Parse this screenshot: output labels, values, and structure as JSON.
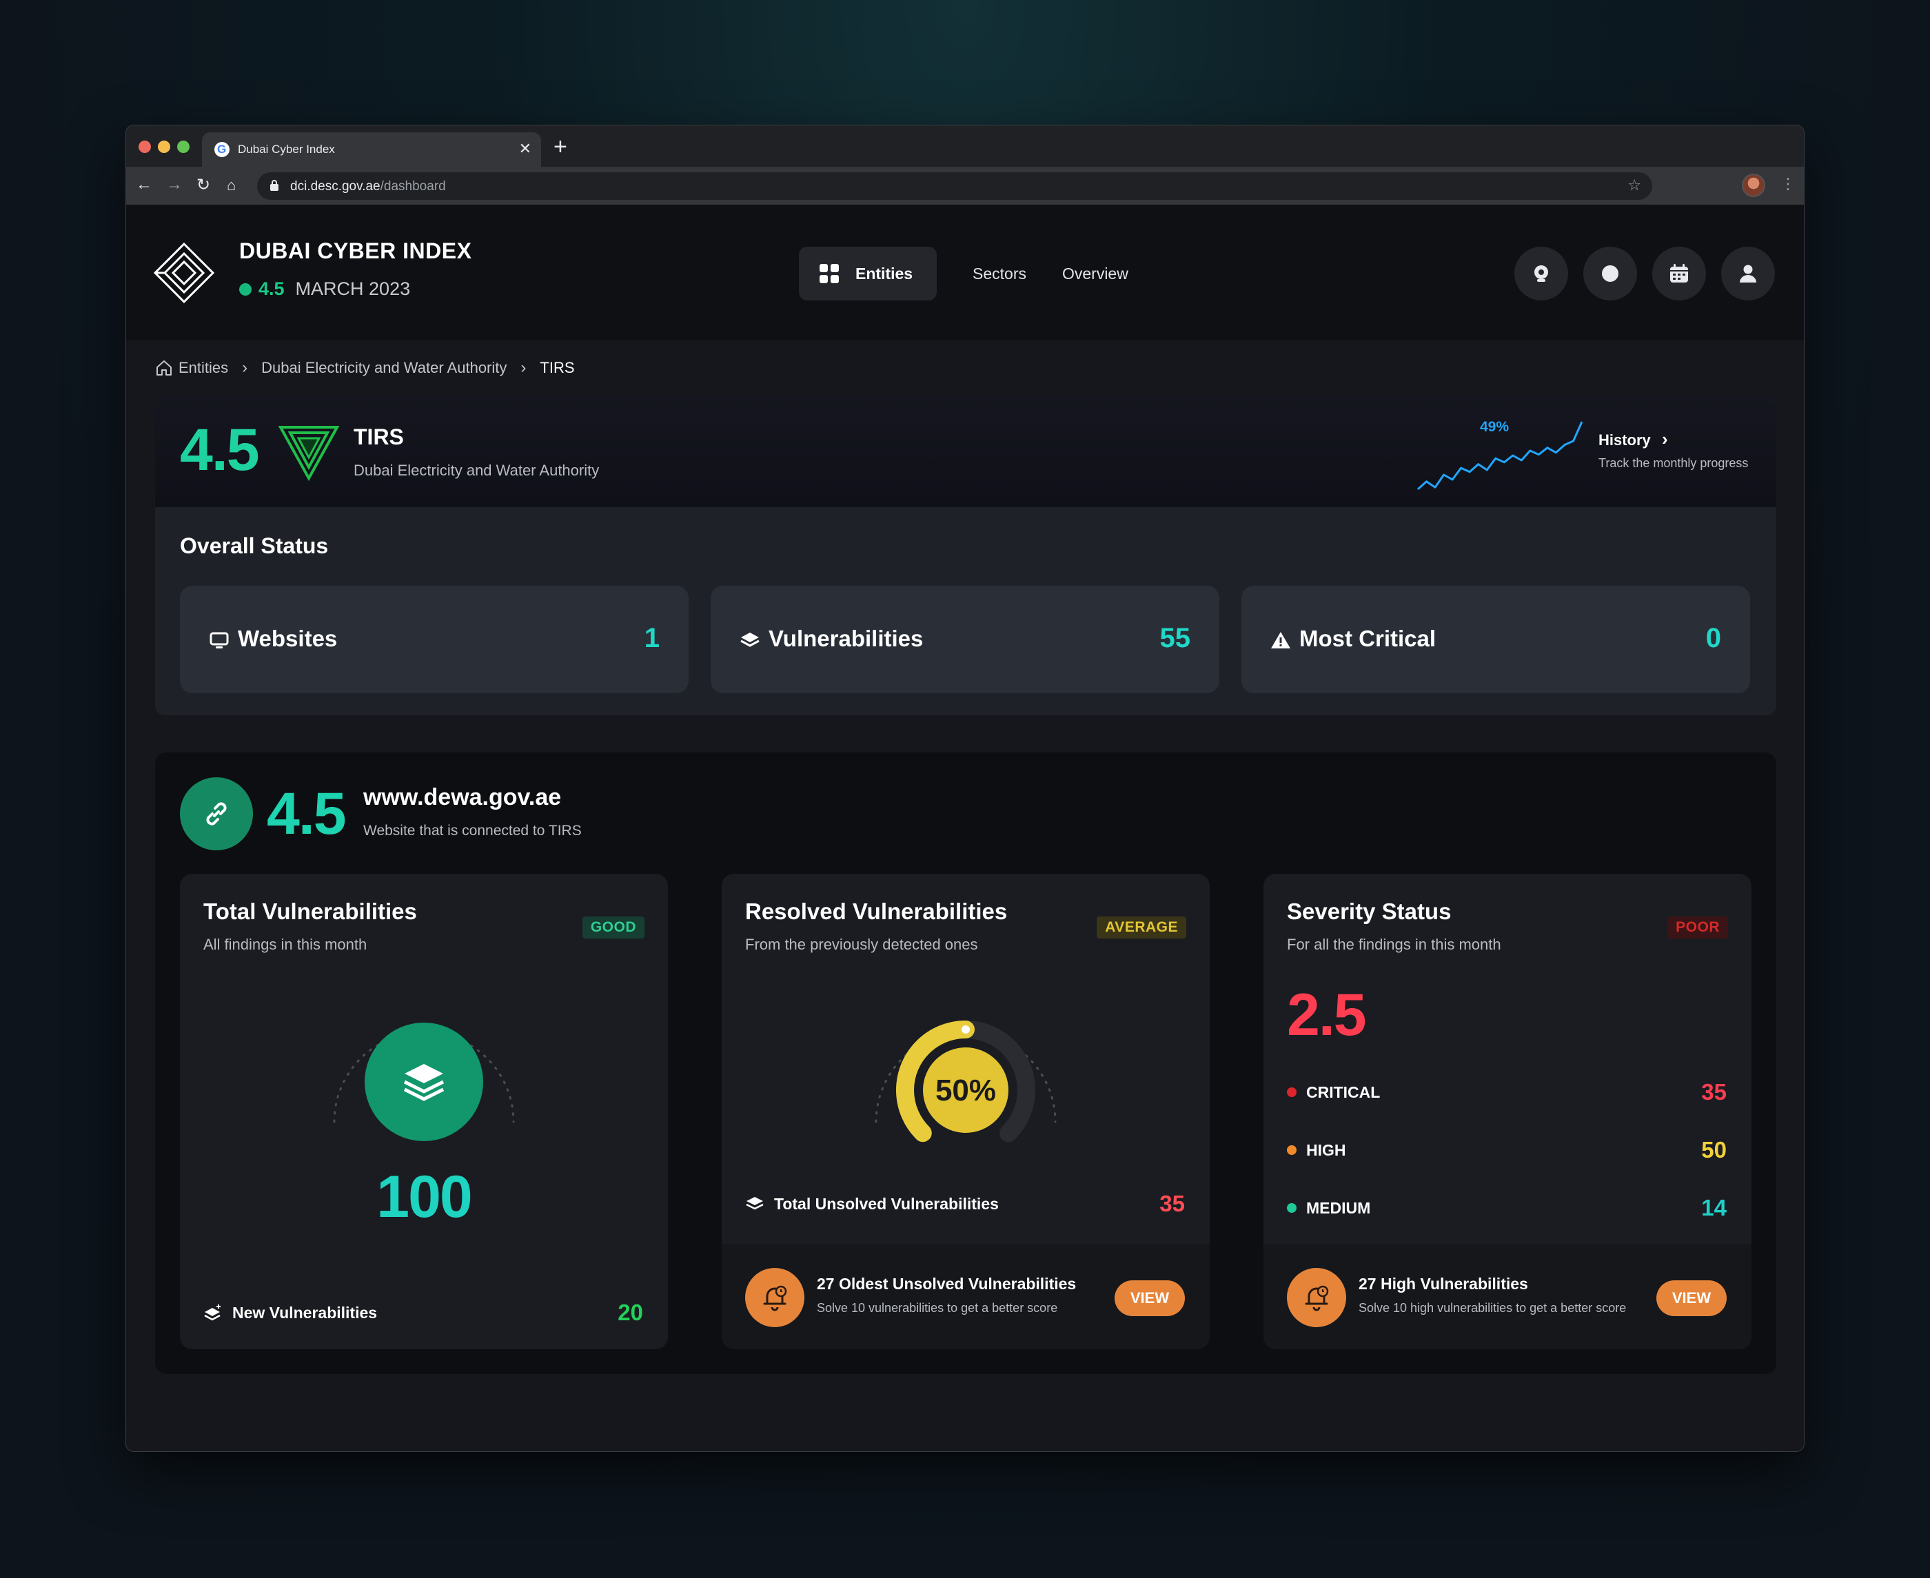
{
  "browser": {
    "tab_title": "Dubai Cyber Index",
    "url_host": "dci.desc.gov.ae",
    "url_path": "/dashboard"
  },
  "header": {
    "title": "DUBAI CYBER INDEX",
    "score": "4.5",
    "period": "MARCH 2023",
    "nav": {
      "entities": "Entities",
      "sectors": "Sectors",
      "overview": "Overview"
    }
  },
  "breadcrumb": [
    "Entities",
    "Dubai Electricity and Water Authority",
    "TIRS"
  ],
  "entity": {
    "score": "4.5",
    "name": "TIRS",
    "org": "Dubai Electricity and Water Authority",
    "trend_label": "49%",
    "trend": [
      20,
      28,
      22,
      35,
      30,
      42,
      38,
      46,
      40,
      52,
      48,
      55,
      50,
      60,
      56,
      63,
      58,
      66,
      70,
      90
    ],
    "history_title": "History",
    "history_sub": "Track the monthly progress"
  },
  "overall": {
    "title": "Overall Status",
    "websites_label": "Websites",
    "websites_value": "1",
    "vulns_label": "Vulnerabilities",
    "vulns_value": "55",
    "critical_label": "Most Critical",
    "critical_value": "0"
  },
  "site": {
    "score": "4.5",
    "url": "www.dewa.gov.ae",
    "desc": "Website that is connected  to TIRS"
  },
  "total": {
    "title": "Total Vulnerabilities",
    "sub": "All findings in this month",
    "badge": "GOOD",
    "value": "100",
    "new_label": "New Vulnerabilities",
    "new_value": "20"
  },
  "resolved": {
    "title": "Resolved Vulnerabilities",
    "sub": "From the previously detected ones",
    "badge": "AVERAGE",
    "percent_text": "50%",
    "percent": 0.5,
    "unsolved_label": "Total Unsolved Vulnerabilities",
    "unsolved_value": "35",
    "footer_title": "27 Oldest Unsolved Vulnerabilities",
    "footer_sub": "Solve 10 vulnerabilities to get a better score",
    "button": "VIEW"
  },
  "severity": {
    "title": "Severity Status",
    "sub": "For all the findings in this month",
    "badge": "POOR",
    "score": "2.5",
    "critical_label": "CRITICAL",
    "critical_value": "35",
    "high_label": "HIGH",
    "high_value": "50",
    "medium_label": "MEDIUM",
    "medium_value": "14",
    "footer_title": "27 High Vulnerabilities",
    "footer_sub": "Solve 10 high vulnerabilities to get a better score",
    "button": "VIEW"
  },
  "colors": {
    "accent_green": "#1ed3a0",
    "accent_teal": "#20d8c8",
    "poor_red": "#ff3d51",
    "average_yellow": "#e4c533",
    "orange": "#e6853a"
  }
}
